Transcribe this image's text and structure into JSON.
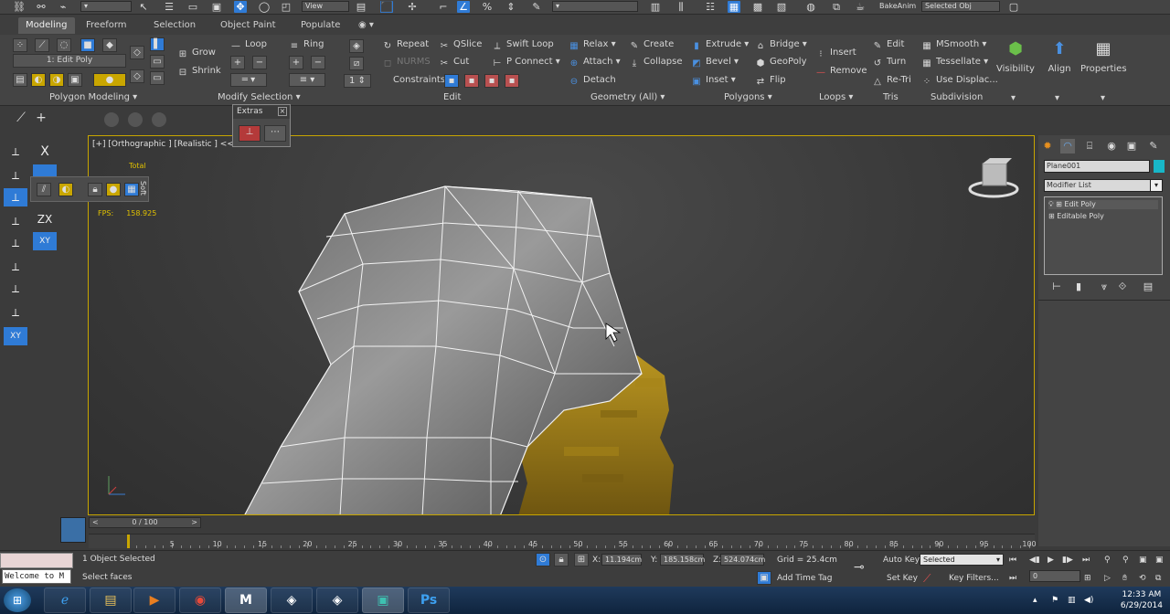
{
  "top_toolbar": {
    "view_dropdown": "View",
    "bake_anim": "BakeAnim",
    "selected_obj": "Selected Obj"
  },
  "ribbon_tabs": [
    "Modeling",
    "Freeform",
    "Selection",
    "Object Paint",
    "Populate"
  ],
  "ribbon": {
    "polygon_modeling": {
      "current": "1: Edit Poly",
      "title": "Polygon Modeling"
    },
    "modify_selection": {
      "grow": "Grow",
      "shrink": "Shrink",
      "loop": "Loop",
      "ring": "Ring",
      "title": "Modify Selection"
    },
    "edit": {
      "repeat": "Repeat",
      "qslice": "QSlice",
      "swift_loop": "Swift Loop",
      "nurms": "NURMS",
      "cut": "Cut",
      "p_connect": "P Connect",
      "constraints": "Constraints",
      "title": "Edit"
    },
    "geometry": {
      "relax": "Relax",
      "create": "Create",
      "attach": "Attach",
      "collapse": "Collapse",
      "detach": "Detach",
      "title": "Geometry (All)"
    },
    "polygons": {
      "extrude": "Extrude",
      "bridge": "Bridge",
      "bevel": "Bevel",
      "geopoly": "GeoPoly",
      "inset": "Inset",
      "flip": "Flip",
      "title": "Polygons"
    },
    "loops": {
      "insert": "Insert",
      "remove": "Remove",
      "title": "Loops"
    },
    "tris": {
      "edit": "Edit",
      "turn": "Turn",
      "retri": "Re-Tri",
      "title": "Tris"
    },
    "subdivision": {
      "msmooth": "MSmooth",
      "tessellate": "Tessellate",
      "use_displac": "Use Displac...",
      "title": "Subdivision"
    },
    "visibility": "Visibility",
    "align": "Align",
    "properties": "Properties"
  },
  "extras": {
    "title": "Extras"
  },
  "left_toolbar": {
    "x_label": "X",
    "zx_label": "ZX",
    "xy_label": "XY",
    "xy_label2": "XY"
  },
  "viewport": {
    "label": "[+] [Orthographic ] [Realistic ] <<Disa",
    "total": "Total",
    "fps_label": "FPS:",
    "fps_value": "158.925",
    "floater_text": "Soft"
  },
  "command_panel": {
    "object_name": "Plane001",
    "object_color": "#18b7c8",
    "modifier_list": "Modifier List",
    "stack": [
      "Edit Poly",
      "Editable Poly"
    ]
  },
  "timeline": {
    "slider": "0 / 100",
    "ticks": [
      "5",
      "10",
      "15",
      "20",
      "25",
      "30",
      "35",
      "40",
      "45",
      "50",
      "55",
      "60",
      "65",
      "70",
      "75",
      "80",
      "85",
      "90",
      "95",
      "100"
    ]
  },
  "status": {
    "selected_count": "1 Object Selected",
    "prompt": "Select faces",
    "welcome": "Welcome to M",
    "x_label": "X:",
    "x_value": "11.194cm",
    "y_label": "Y:",
    "y_value": "185.158cm",
    "z_label": "Z:",
    "z_value": "524.074cm",
    "grid": "Grid = 25.4cm",
    "add_time_tag": "Add Time Tag",
    "auto_key": "Auto Key",
    "selected_dropdown": "Selected",
    "set_key": "Set Key",
    "key_filters": "Key Filters...",
    "frame": "0"
  },
  "taskbar": {
    "time": "12:33 AM",
    "date": "6/29/2014"
  }
}
